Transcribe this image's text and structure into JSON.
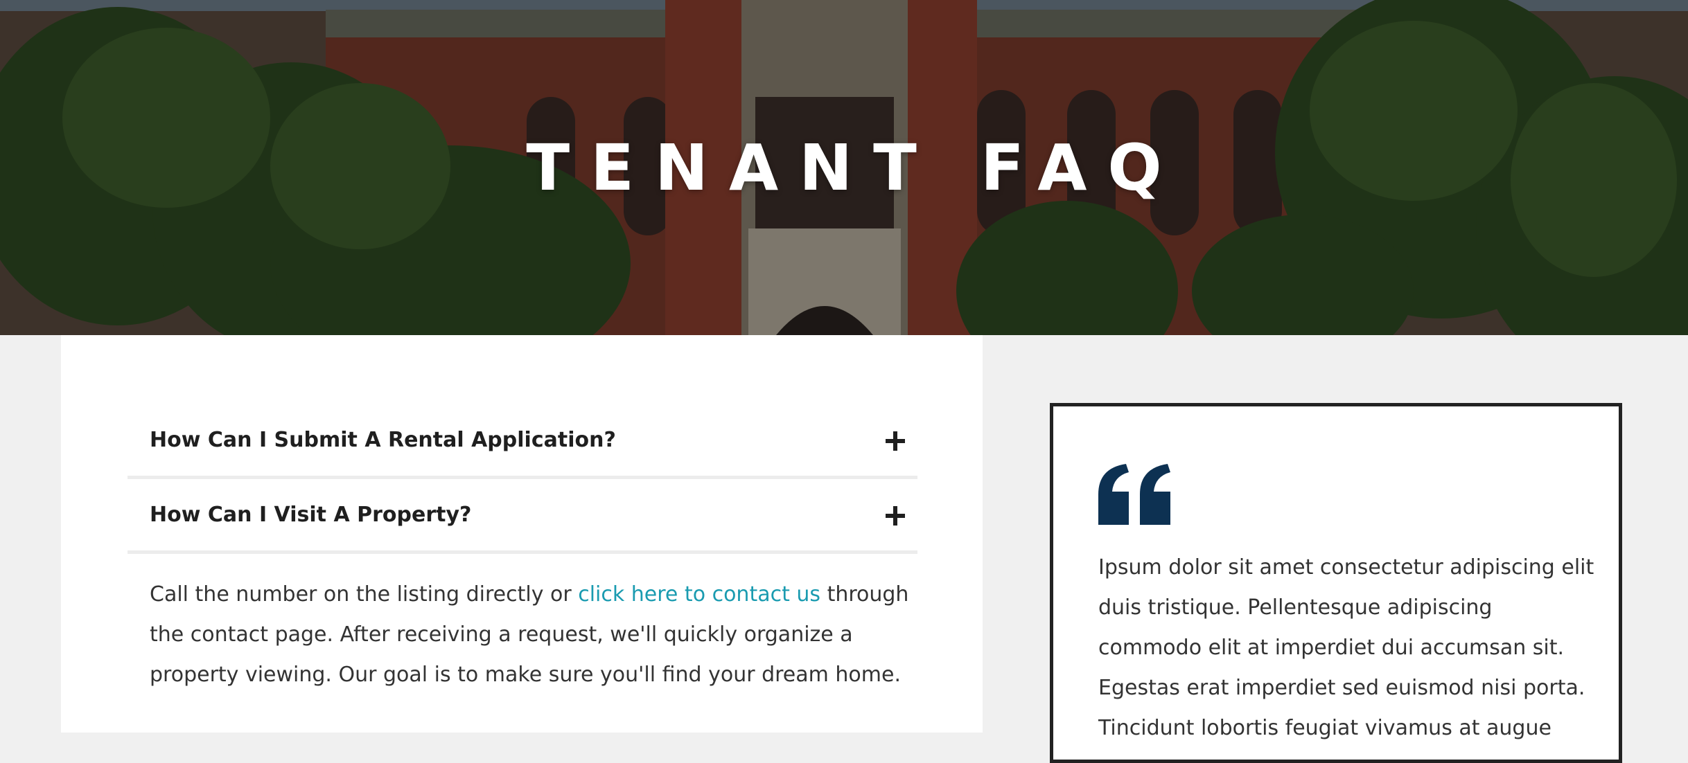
{
  "hero": {
    "title": "TENANT FAQ"
  },
  "faq": {
    "items": [
      {
        "question": "How Can I Submit A Rental Application?",
        "expanded": false,
        "toggle_icon": "plus-icon"
      },
      {
        "question": "How Can I Visit A Property?",
        "expanded": true,
        "toggle_icon": "plus-icon"
      }
    ],
    "answer": {
      "before": "Call the number on the listing directly or ",
      "link": "click here to contact us",
      "after": " through the contact page. After receiving a request, we'll quickly organize a property viewing. Our goal is to make sure you'll find your dream home."
    },
    "link_color": "#1a9bb0"
  },
  "quote": {
    "icon": "quote-icon",
    "icon_color": "#0d3152",
    "text": "Ipsum dolor sit amet consectetur adipiscing elit duis tristique. Pellentesque adipiscing commodo elit at imperdiet dui accumsan sit. Egestas erat imperdiet sed euismod nisi porta. Tincidunt lobortis feugiat vivamus at augue"
  }
}
